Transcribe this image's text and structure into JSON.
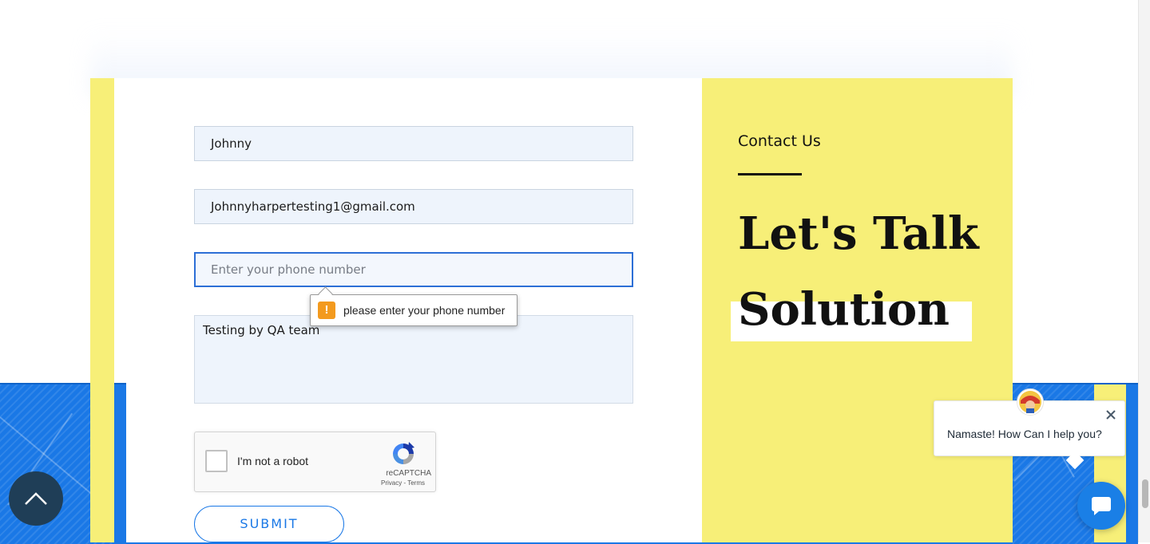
{
  "form": {
    "name_value": "Johnny",
    "email_value": "Johnnyharpertesting1@gmail.com",
    "phone_value": "",
    "phone_placeholder": "Enter your phone number",
    "message_value": "Testing by QA team",
    "validation_message": "please enter your phone number",
    "validation_icon": "warning-icon",
    "submit_label": "SUBMIT"
  },
  "captcha": {
    "label": "I'm not a robot",
    "brand": "reCAPTCHA",
    "links": "Privacy - Terms",
    "checked": false
  },
  "contact": {
    "eyebrow": "Contact Us",
    "headline_line1": "Let's Talk",
    "headline_line2": "Solution"
  },
  "chat": {
    "greeting": "Namaste! How Can I help you?",
    "close_icon": "close-icon",
    "launcher_icon": "chat-icon"
  },
  "scroll_top_icon": "arrow-up-icon",
  "colors": {
    "accent_blue": "#1a78e6",
    "panel_yellow": "#f7ef78",
    "focus_border": "#2d6fd6",
    "warning_orange": "#f39a1e",
    "scroll_button": "#1f3e57"
  }
}
